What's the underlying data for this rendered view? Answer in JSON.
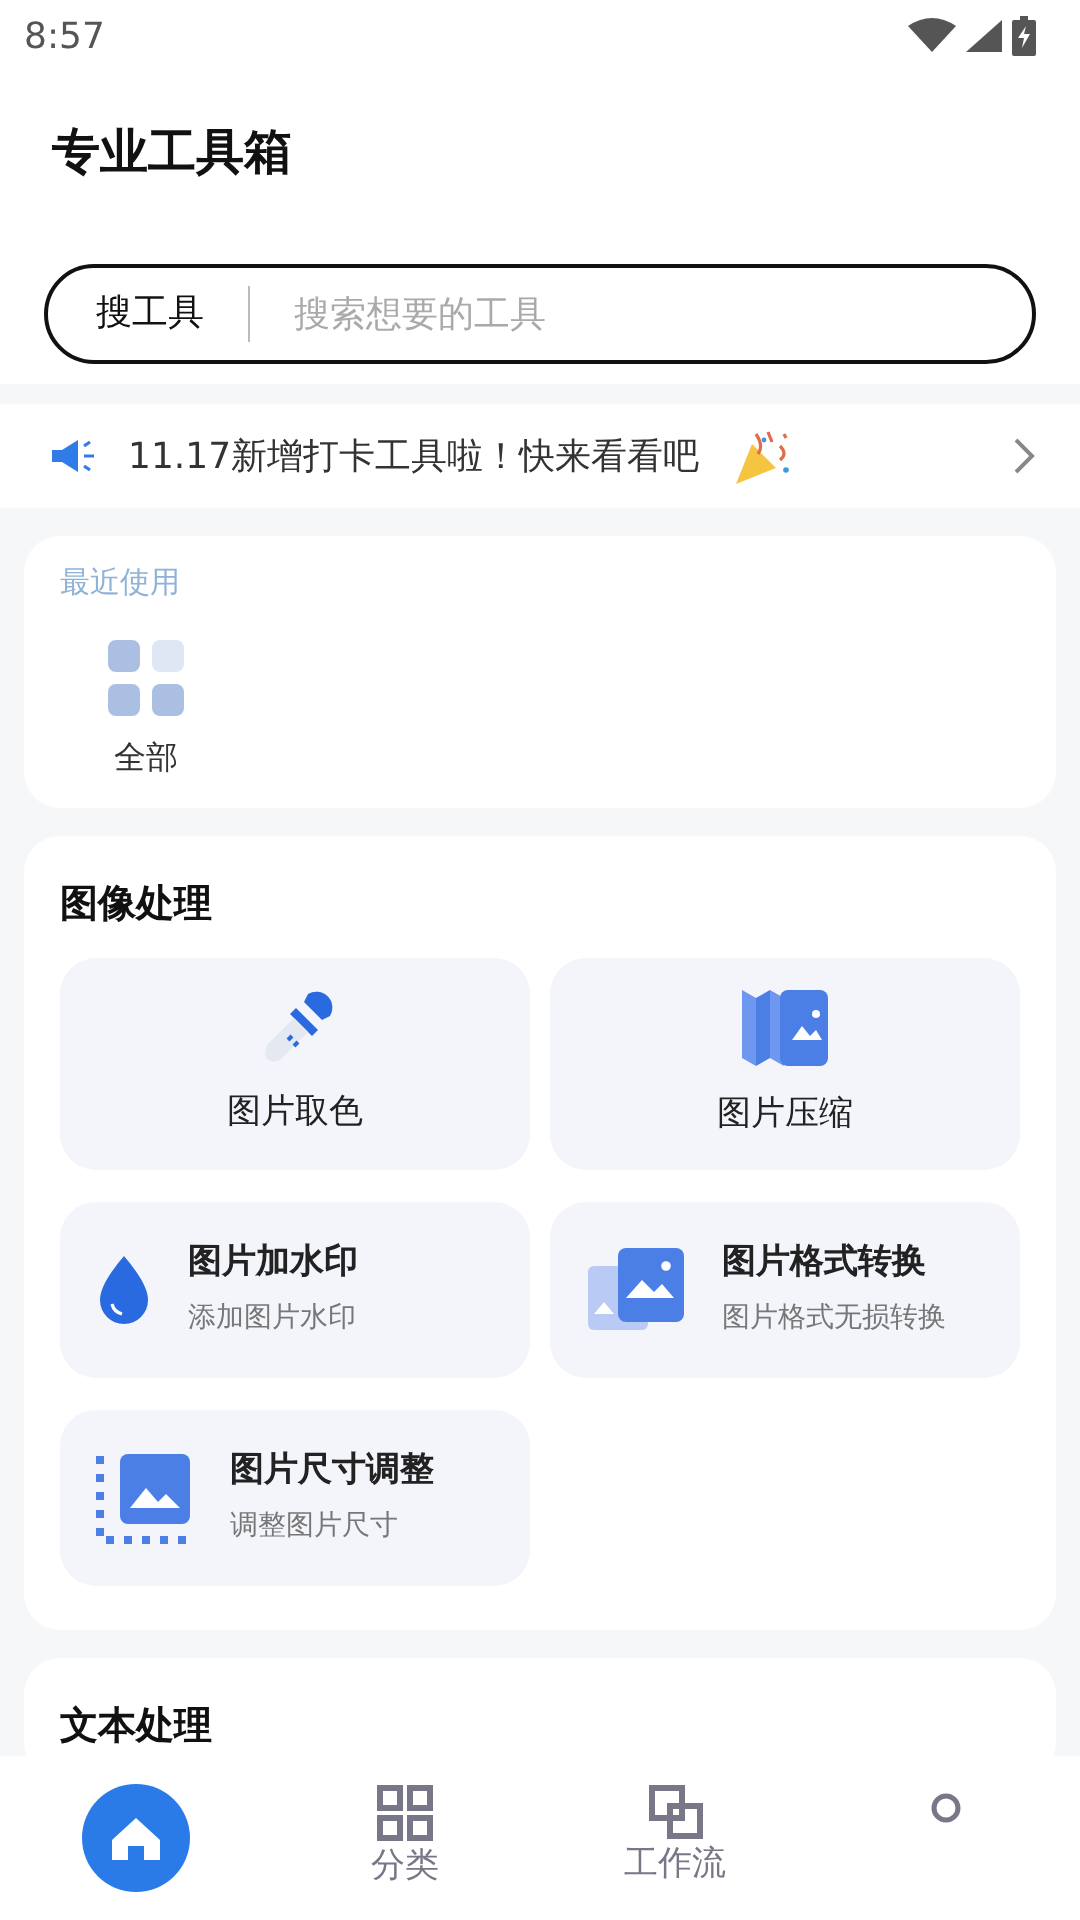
{
  "status_bar": {
    "time": "8:57"
  },
  "header": {
    "title": "专业工具箱"
  },
  "search": {
    "label": "搜工具",
    "placeholder": "搜索想要的工具"
  },
  "notice": {
    "text": "11.17新增打卡工具啦！快来看看吧"
  },
  "recent": {
    "title": "最近使用",
    "items": [
      {
        "label": "全部"
      }
    ]
  },
  "sections": [
    {
      "title": "图像处理",
      "tools": [
        {
          "kind": "tile",
          "title": "图片取色"
        },
        {
          "kind": "tile",
          "title": "图片压缩"
        },
        {
          "kind": "row",
          "title": "图片加水印",
          "subtitle": "添加图片水印"
        },
        {
          "kind": "row",
          "title": "图片格式转换",
          "subtitle": "图片格式无损转换"
        },
        {
          "kind": "row",
          "title": "图片尺寸调整",
          "subtitle": "调整图片尺寸"
        }
      ]
    },
    {
      "title": "文本处理"
    }
  ],
  "nav": [
    {
      "selected": true
    },
    {
      "label": "分类",
      "selected": false
    },
    {
      "label": "工作流",
      "selected": false
    },
    {
      "selected": false
    }
  ]
}
